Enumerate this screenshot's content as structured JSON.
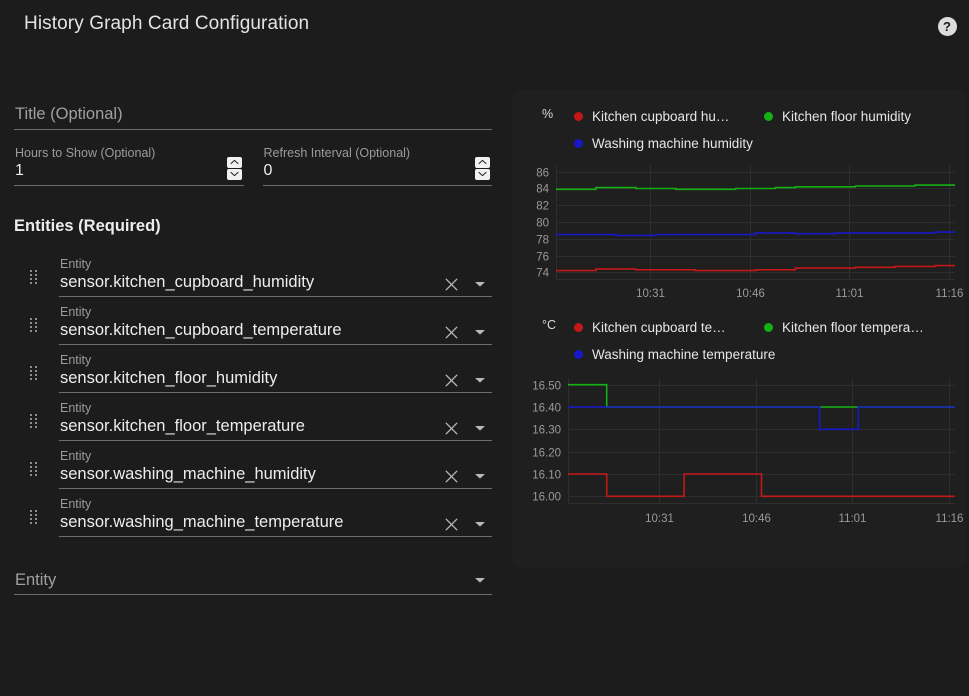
{
  "dialog": {
    "title": "History Graph Card Configuration",
    "help_icon": "help-circle-icon",
    "help_label": "?"
  },
  "form": {
    "title_field": {
      "label": "Title (Optional)",
      "value": "",
      "placeholder": "Title (Optional)"
    },
    "hours_field": {
      "label": "Hours to Show (Optional)",
      "value": "1"
    },
    "refresh_field": {
      "label": "Refresh Interval (Optional)",
      "value": "0"
    },
    "entities_heading": "Entities (Required)",
    "entity_label": "Entity",
    "entities": [
      {
        "label": "Entity",
        "value": "sensor.kitchen_cupboard_humidity"
      },
      {
        "label": "Entity",
        "value": "sensor.kitchen_cupboard_temperature"
      },
      {
        "label": "Entity",
        "value": "sensor.kitchen_floor_humidity"
      },
      {
        "label": "Entity",
        "value": "sensor.kitchen_floor_temperature"
      },
      {
        "label": "Entity",
        "value": "sensor.washing_machine_humidity"
      },
      {
        "label": "Entity",
        "value": "sensor.washing_machine_temperature"
      }
    ],
    "new_entity": {
      "placeholder": "Entity"
    },
    "icons": {
      "drag": "drag-handle-icon",
      "clear": "clear-icon",
      "dropdown": "chevron-down-icon",
      "spin_up": "chevron-up-icon",
      "spin_down": "chevron-down-icon"
    }
  },
  "colors": {
    "series_red": "#c41818",
    "series_green": "#13b013",
    "series_blue": "#1818c8",
    "grid": "#2e2e2e",
    "axis_text": "#9a9a9a",
    "card_bg": "#1f1f1f",
    "page_bg": "#1c1c1c"
  },
  "chart_data": [
    {
      "type": "line",
      "title": "",
      "unit": "%",
      "ylabel": "%",
      "xlabel": "",
      "ylim": [
        73.2,
        86.8
      ],
      "yticks": [
        74,
        76,
        78,
        80,
        82,
        84,
        86
      ],
      "xticks": [
        "10:31",
        "10:46",
        "11:01",
        "11:16"
      ],
      "grid": true,
      "legend_position": "top",
      "series": [
        {
          "name": "Kitchen cupboard humidity",
          "legend_label": "Kitchen cupboard hu…",
          "color": "#c41818",
          "values": [
            74.2,
            74.2,
            74.4,
            74.4,
            74.3,
            74.3,
            74.3,
            74.2,
            74.2,
            74.2,
            74.3,
            74.3,
            74.5,
            74.5,
            74.5,
            74.6,
            74.6,
            74.7,
            74.7,
            74.8
          ]
        },
        {
          "name": "Kitchen floor humidity",
          "legend_label": "Kitchen floor humidity",
          "color": "#13b013",
          "values": [
            83.9,
            83.9,
            84.1,
            84.1,
            84.0,
            84.0,
            83.9,
            83.9,
            83.9,
            84.0,
            84.0,
            84.1,
            84.2,
            84.2,
            84.2,
            84.3,
            84.3,
            84.3,
            84.4,
            84.4
          ]
        },
        {
          "name": "Washing machine humidity",
          "legend_label": "Washing machine humidity",
          "color": "#1818c8",
          "values": [
            78.5,
            78.5,
            78.5,
            78.4,
            78.4,
            78.5,
            78.5,
            78.5,
            78.5,
            78.5,
            78.7,
            78.7,
            78.6,
            78.6,
            78.7,
            78.7,
            78.7,
            78.7,
            78.7,
            78.8
          ]
        }
      ]
    },
    {
      "type": "line",
      "title": "",
      "unit": "°C",
      "ylabel": "°C",
      "xlabel": "",
      "ylim": [
        15.97,
        16.53
      ],
      "yticks": [
        "16.00",
        "16.10",
        "16.20",
        "16.30",
        "16.40",
        "16.50"
      ],
      "xticks": [
        "10:31",
        "10:46",
        "11:01",
        "11:16"
      ],
      "grid": true,
      "legend_position": "top",
      "series": [
        {
          "name": "Kitchen cupboard temperature",
          "legend_label": "Kitchen cupboard te…",
          "color": "#c41818",
          "values": [
            16.1,
            16.1,
            16.0,
            16.0,
            16.0,
            16.0,
            16.1,
            16.1,
            16.1,
            16.1,
            16.0,
            16.0,
            16.0,
            16.0,
            16.0,
            16.0,
            16.0,
            16.0,
            16.0,
            16.0
          ]
        },
        {
          "name": "Kitchen floor temperature",
          "legend_label": "Kitchen floor tempera…",
          "color": "#13b013",
          "values": [
            16.5,
            16.5,
            16.4,
            16.4,
            16.4,
            16.4,
            16.4,
            16.4,
            16.4,
            16.4,
            16.4,
            16.4,
            16.4,
            16.4,
            16.4,
            16.4,
            16.4,
            16.4,
            16.4,
            16.4
          ]
        },
        {
          "name": "Washing machine temperature",
          "legend_label": "Washing machine temperature",
          "color": "#1818c8",
          "values": [
            16.4,
            16.4,
            16.4,
            16.4,
            16.4,
            16.4,
            16.4,
            16.4,
            16.4,
            16.4,
            16.4,
            16.4,
            16.4,
            16.3,
            16.3,
            16.4,
            16.4,
            16.4,
            16.4,
            16.4
          ]
        }
      ]
    }
  ]
}
